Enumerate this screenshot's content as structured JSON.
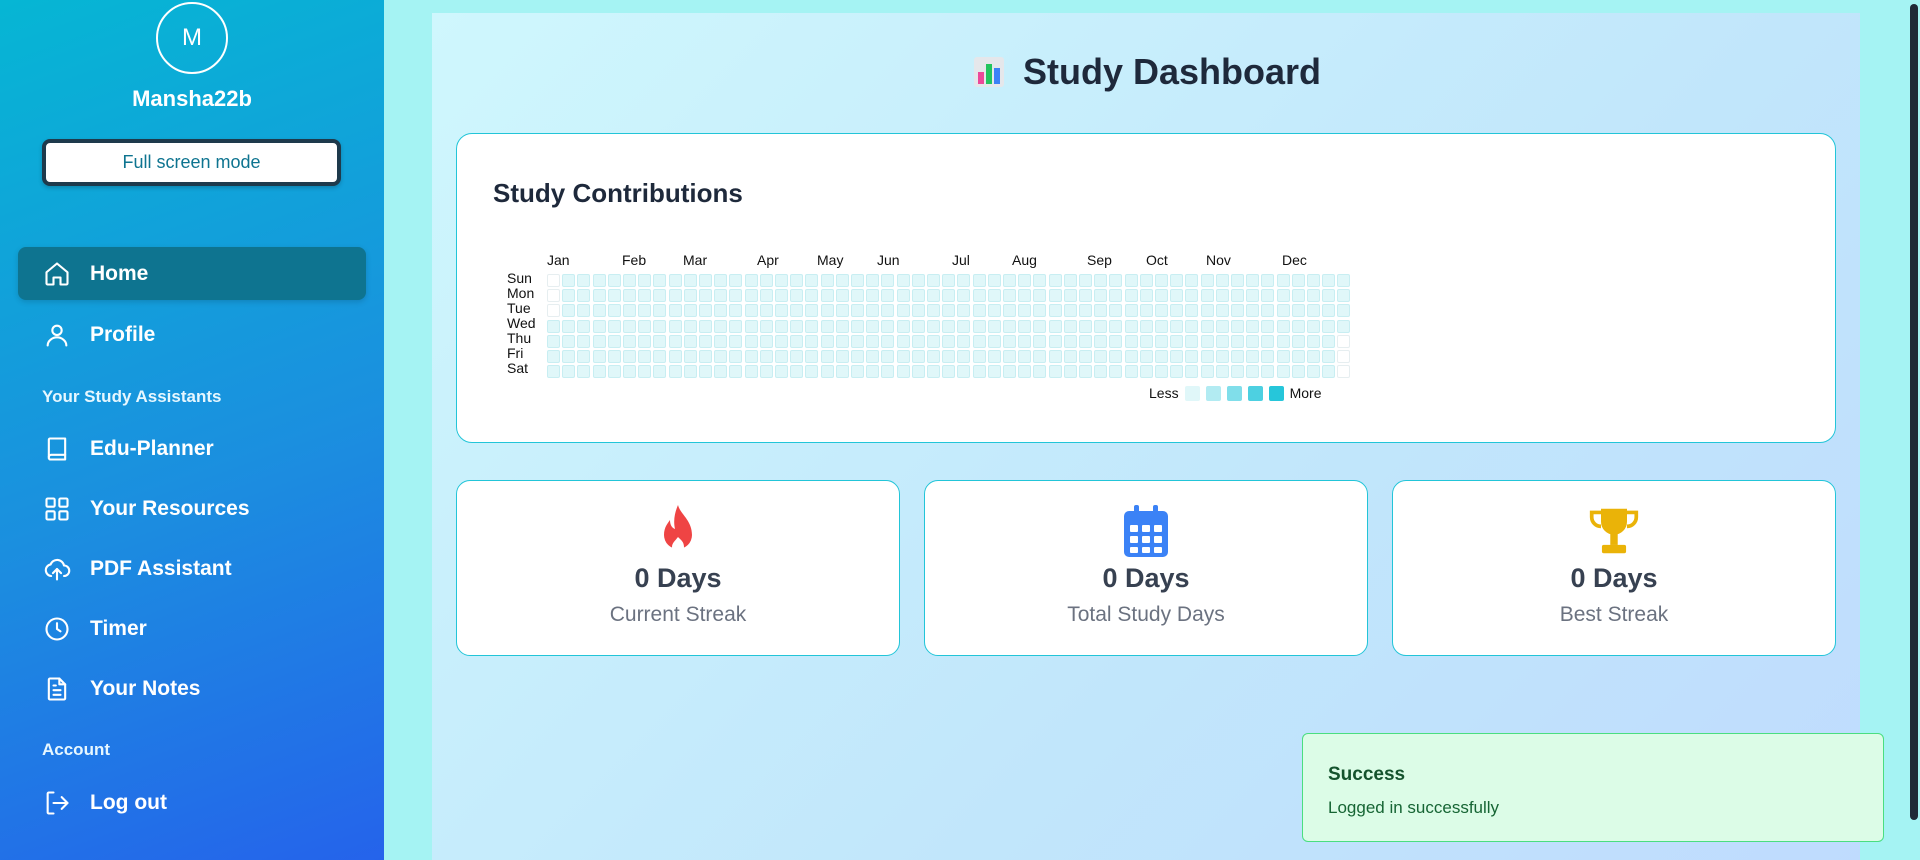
{
  "sidebar": {
    "avatar_initial": "M",
    "username": "Mansha22b",
    "fullscreen_label": "Full screen mode",
    "nav": {
      "home": "Home",
      "profile": "Profile",
      "assistants_heading": "Your Study Assistants",
      "edu_planner": "Edu-Planner",
      "resources": "Your Resources",
      "pdf_assistant": "PDF Assistant",
      "timer": "Timer",
      "notes": "Your Notes",
      "account_heading": "Account",
      "logout": "Log out"
    }
  },
  "main": {
    "title": "Study Dashboard",
    "contributions": {
      "title": "Study Contributions",
      "months": [
        "Jan",
        "Feb",
        "Mar",
        "Apr",
        "May",
        "Jun",
        "Jul",
        "Aug",
        "Sep",
        "Oct",
        "Nov",
        "Dec"
      ],
      "days": [
        "Sun",
        "Mon",
        "Tue",
        "Wed",
        "Thu",
        "Fri",
        "Sat"
      ],
      "legend_less": "Less",
      "legend_more": "More",
      "legend_colors": [
        "#e0f7f9",
        "#b2ebf2",
        "#80deea",
        "#4dd0e1",
        "#26c6da"
      ]
    },
    "stats": {
      "current_streak": {
        "value": "0 Days",
        "label": "Current Streak",
        "icon": "fire-icon",
        "color": "#ef4444"
      },
      "total_days": {
        "value": "0 Days",
        "label": "Total Study Days",
        "icon": "calendar-icon",
        "color": "#3b82f6"
      },
      "best_streak": {
        "value": "0 Days",
        "label": "Best Streak",
        "icon": "trophy-icon",
        "color": "#eab308"
      }
    }
  },
  "toast": {
    "title": "Success",
    "message": "Logged in successfully"
  }
}
